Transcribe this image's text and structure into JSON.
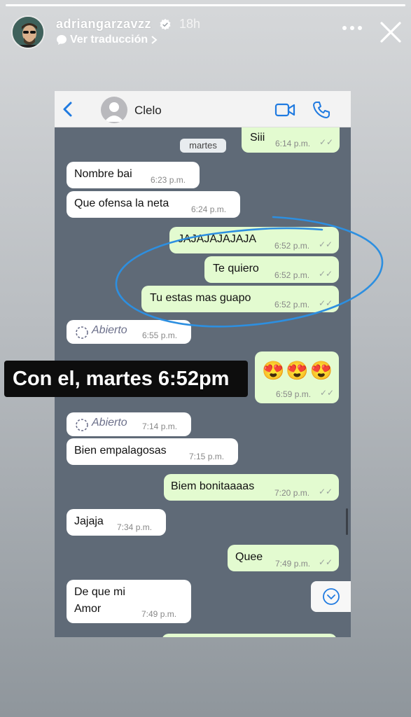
{
  "story": {
    "progress": 1.0,
    "username": "adriangarzavzz",
    "time": "18h",
    "translate_label": "Ver traducción",
    "icons": {
      "verified": "verified-badge-icon",
      "more": "more-dots-icon",
      "close": "close-icon",
      "chevron": "chevron-right-icon"
    }
  },
  "chat": {
    "contact_name": "Clelo",
    "date_label": "martes",
    "icons": {
      "back": "back-icon",
      "video": "video-call-icon",
      "call": "phone-call-icon",
      "scroll_down": "chevron-down-circle-icon"
    },
    "messages": [
      {
        "dir": "out",
        "text": "Siii",
        "time": "6:14 p.m."
      },
      {
        "dir": "in",
        "text": "Nombre bai",
        "time": "6:23 p.m."
      },
      {
        "dir": "in",
        "text": "Que ofensa la neta",
        "time": "6:24 p.m."
      },
      {
        "dir": "out",
        "text": "JAJAJAJAJAJA",
        "time": "6:52 p.m."
      },
      {
        "dir": "out",
        "text": "Te quiero",
        "time": "6:52 p.m."
      },
      {
        "dir": "out",
        "text": "Tu estas mas guapo",
        "time": "6:52 p.m."
      },
      {
        "dir": "in",
        "text": "Abierto",
        "time": "6:55 p.m.",
        "type": "view-once-opened"
      },
      {
        "dir": "out",
        "text": "😍😍😍",
        "time": "6:59 p.m.",
        "type": "emoji"
      },
      {
        "dir": "in",
        "text": "Abierto",
        "time": "7:14 p.m.",
        "type": "view-once-opened"
      },
      {
        "dir": "in",
        "text": "Bien empalagosas",
        "time": "7:15 p.m."
      },
      {
        "dir": "out",
        "text": "Biem bonitaaaas",
        "time": "7:20 p.m."
      },
      {
        "dir": "in",
        "text": "Jajaja",
        "time": "7:34 p.m."
      },
      {
        "dir": "out",
        "text": "Quee",
        "time": "7:49 p.m."
      },
      {
        "dir": "in",
        "text_line1": "De que mi",
        "text_line2": "Amor",
        "time": "7:49 p.m."
      }
    ]
  },
  "caption": "Con el, martes 6:52pm",
  "colors": {
    "incoming_bubble": "#ffffff",
    "outgoing_bubble": "#e3fbd0",
    "chat_background": "#5f6a77",
    "annotation_circle": "#2d8fe0",
    "header_icon_blue": "#1f7ae0"
  }
}
